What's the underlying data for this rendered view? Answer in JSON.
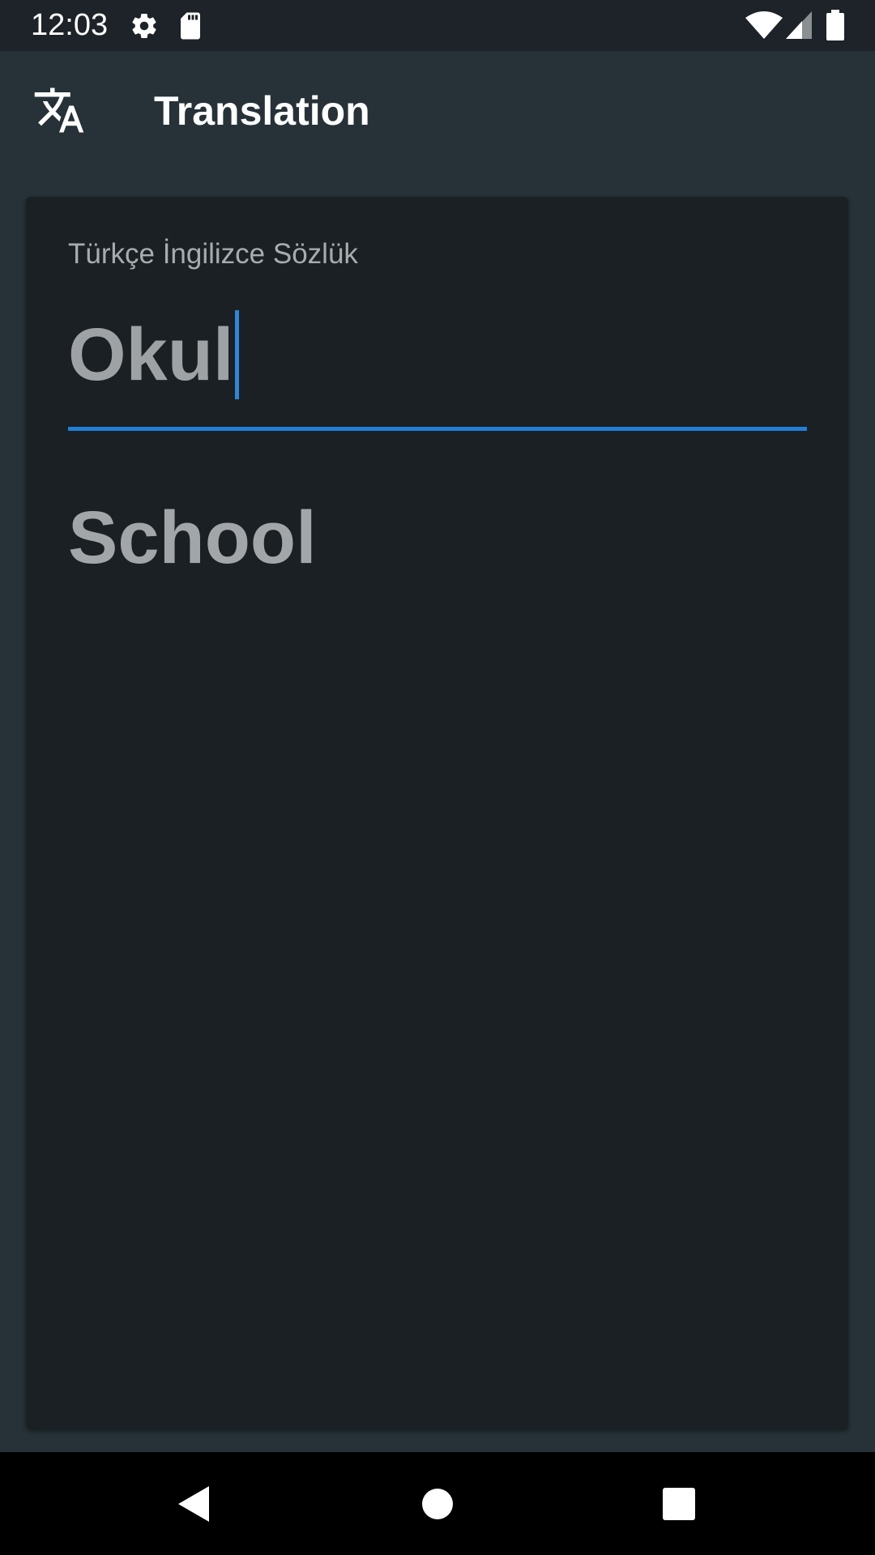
{
  "status_bar": {
    "time": "12:03",
    "icons": [
      "settings-icon",
      "sd-card-icon",
      "wifi-icon",
      "signal-icon",
      "battery-icon"
    ]
  },
  "app_bar": {
    "icon": "translate-icon",
    "title": "Translation"
  },
  "translator": {
    "input_label": "Türkçe İngilizce Sözlük",
    "input_value": "Okul",
    "result": "School"
  },
  "nav_bar": {
    "buttons": [
      "back-icon",
      "home-icon",
      "recents-icon"
    ]
  },
  "colors": {
    "background": "#263238",
    "card": "#1b2024",
    "accent": "#1f7fd6",
    "text_muted": "#9ea2a5"
  }
}
